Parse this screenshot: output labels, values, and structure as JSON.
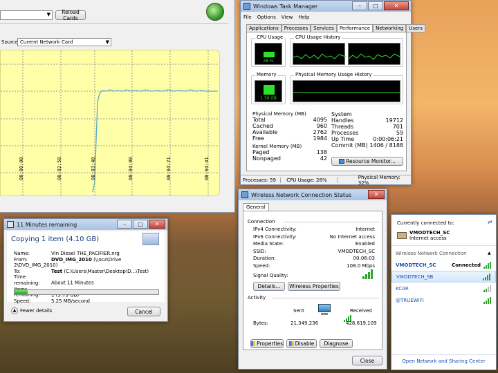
{
  "network_tool": {
    "reload_label": "Reload Cards",
    "source_label": "Source",
    "source_value": "Current Network Card",
    "time_ticks": [
      "00:00:00",
      "00:02:58",
      "00:03:40",
      "00:04:00",
      "00:04:21",
      "00:04:41"
    ]
  },
  "task_manager": {
    "title": "Windows Task Manager",
    "menu": [
      "File",
      "Options",
      "View",
      "Help"
    ],
    "tabs": [
      "Applications",
      "Processes",
      "Services",
      "Performance",
      "Networking",
      "Users"
    ],
    "active_tab": "Performance",
    "cpu_usage_title": "CPU Usage",
    "cpu_usage_value": "28 %",
    "cpu_history_title": "CPU Usage History",
    "memory_title": "Memory",
    "memory_value": "1.30 GB",
    "mem_history_title": "Physical Memory Usage History",
    "physical_memory": {
      "title": "Physical Memory (MB)",
      "rows": [
        [
          "Total",
          "4095"
        ],
        [
          "Cached",
          "960"
        ],
        [
          "Available",
          "2762"
        ],
        [
          "Free",
          "1984"
        ]
      ]
    },
    "kernel_memory": {
      "title": "Kernel Memory (MB)",
      "rows": [
        [
          "Paged",
          "138"
        ],
        [
          "Nonpaged",
          "42"
        ]
      ]
    },
    "system": {
      "title": "System",
      "rows": [
        [
          "Handles",
          "19712"
        ],
        [
          "Threads",
          "701"
        ],
        [
          "Processes",
          "59"
        ],
        [
          "Up Time",
          "0:00:06:21"
        ],
        [
          "Commit (MB)",
          "1406 / 8188"
        ]
      ]
    },
    "resource_monitor_label": "Resource Monitor...",
    "status": {
      "processes": "Processes: 59",
      "cpu": "CPU Usage: 28%",
      "memory": "Physical Memory: 32%"
    }
  },
  "copy_dialog": {
    "title": "11 Minutes remaining",
    "heading": "Copying 1 item (4.10 GB)",
    "rows": [
      {
        "label": "Name:",
        "value": "Vin Diesel THE_PACIFIER.nrg",
        "bold_part": ""
      },
      {
        "label": "From:",
        "value": "(\\\\ocz\\Drive 2\\DVD_IMG_2010)",
        "bold_part": "DVD_IMG_2010"
      },
      {
        "label": "To:",
        "value": "(C:\\Users\\Master\\Desktop\\D...\\Test)",
        "bold_part": "Test"
      },
      {
        "label": "Time remaining:",
        "value": "About 11 Minutes",
        "bold_part": ""
      },
      {
        "label": "Items remaining:",
        "value": "1 (3.73 GB)",
        "bold_part": ""
      },
      {
        "label": "Speed:",
        "value": "5.25 MB/second",
        "bold_part": ""
      }
    ],
    "progress": 0.09,
    "fewer_details_label": "Fewer details",
    "cancel_label": "Cancel"
  },
  "wifi_status": {
    "title": "Wireless Network Connection Status",
    "tab": "General",
    "connection_title": "Connection",
    "rows": [
      [
        "IPv4 Connectivity:",
        "Internet"
      ],
      [
        "IPv6 Connectivity:",
        "No Internet access"
      ],
      [
        "Media State:",
        "Enabled"
      ],
      [
        "SSID:",
        "VMODTECH_SC"
      ],
      [
        "Duration:",
        "00:06:03"
      ],
      [
        "Speed:",
        "108.0 Mbps"
      ]
    ],
    "signal_label": "Signal Quality:",
    "details_label": "Details...",
    "wireless_props_label": "Wireless Properties",
    "activity_title": "Activity",
    "sent_label": "Sent",
    "received_label": "Received",
    "bytes_label": "Bytes:",
    "bytes_sent": "21,349,236",
    "bytes_received": "428,619,109",
    "properties_label": "Properties",
    "disable_label": "Disable",
    "diagnose_label": "Diagnose",
    "close_label": "Close"
  },
  "network_flyout": {
    "currently_label": "Currently connected to:",
    "current_name": "VMODTECH_SC",
    "current_status": "Internet access",
    "section_label": "Wireless Network Connection",
    "networks": [
      {
        "name": "VMODTECH_SC",
        "status": "Connected"
      },
      {
        "name": "VMODTECH_SB",
        "status": ""
      },
      {
        "name": "KCAR",
        "status": ""
      },
      {
        "name": "@TRUEWIFI",
        "status": ""
      }
    ],
    "footer_link": "Open Network and Sharing Center"
  }
}
